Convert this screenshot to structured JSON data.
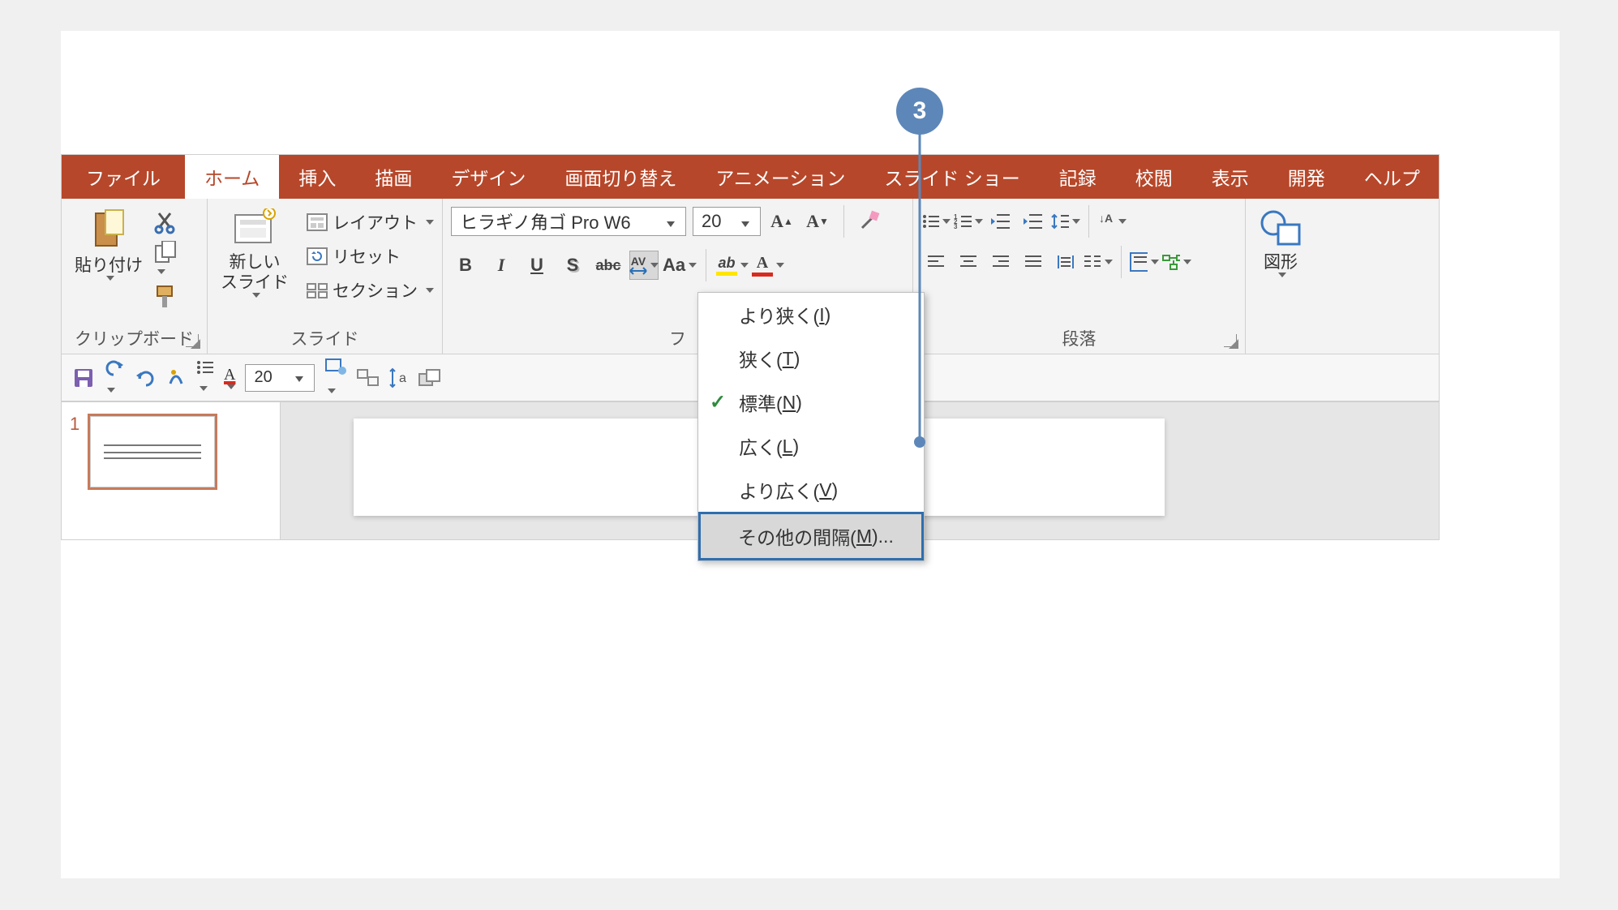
{
  "callout": {
    "number": "3"
  },
  "tabs": {
    "file": "ファイル",
    "items": [
      "ホーム",
      "挿入",
      "描画",
      "デザイン",
      "画面切り替え",
      "アニメーション",
      "スライド ショー",
      "記録",
      "校閲",
      "表示",
      "開発",
      "ヘルプ"
    ],
    "active_index": 0
  },
  "clipboard": {
    "paste": "貼り付け",
    "label": "クリップボード"
  },
  "slides": {
    "new_slide": "新しい\nスライド",
    "layout": "レイアウト",
    "reset": "リセット",
    "section": "セクション",
    "label": "スライド"
  },
  "font": {
    "family": "ヒラギノ角ゴ Pro W6",
    "size": "20",
    "buttons": {
      "bold": "B",
      "italic": "I",
      "underline": "U",
      "shadow": "S",
      "strike": "abc",
      "spacing": "AV",
      "case": "Aa"
    }
  },
  "spacing_menu": {
    "very_tight": "より狭く(",
    "very_tight_k": "I",
    "very_tight_e": ")",
    "tight": "狭く(",
    "tight_k": "T",
    "tight_e": ")",
    "normal": "標準(",
    "normal_k": "N",
    "normal_e": ")",
    "loose": "広く(",
    "loose_k": "L",
    "loose_e": ")",
    "very_loose": "より広く(",
    "very_loose_k": "V",
    "very_loose_e": ")",
    "more": "その他の間隔(",
    "more_k": "M",
    "more_e": ")..."
  },
  "paragraph": {
    "label": "段落"
  },
  "shapes": {
    "label": "図形"
  },
  "qat": {
    "size": "20"
  },
  "thumb": {
    "number": "1"
  }
}
